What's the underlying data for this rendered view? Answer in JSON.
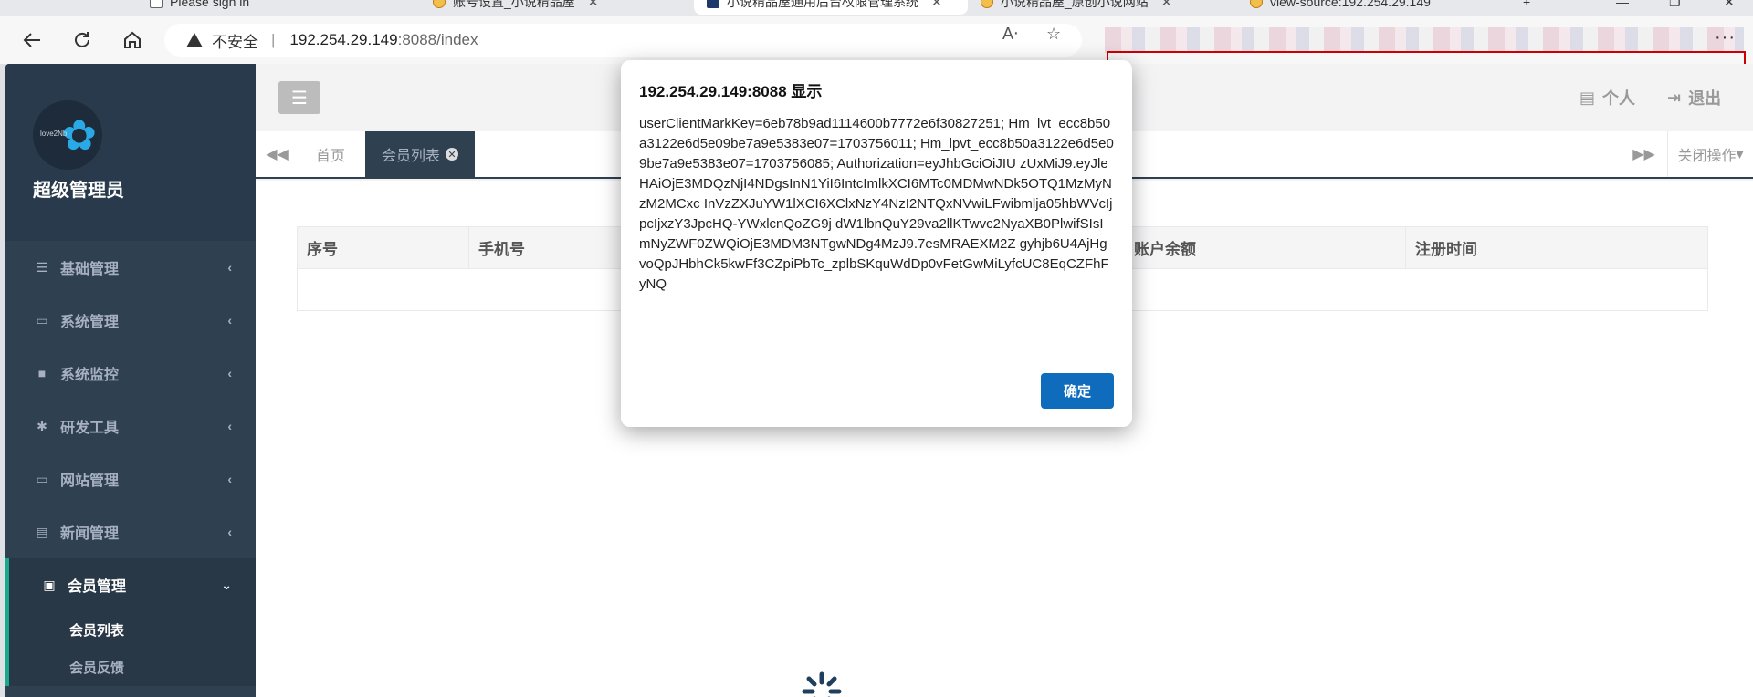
{
  "browser": {
    "tabs": [
      {
        "title": "Please sign in",
        "fav": "doc"
      },
      {
        "title": "账号设置_小说精品屋",
        "fav": "app"
      },
      {
        "title": "小说精品屋通用后台权限管理系统",
        "fav": "blue"
      },
      {
        "title": "小说精品屋_原创小说网站",
        "fav": "app"
      },
      {
        "title": "view-source:192.254.29.149",
        "fav": "app"
      }
    ],
    "address": {
      "insecure_label": "不安全",
      "separator": "|",
      "host": "192.254.29.149",
      "path": ":8088/index"
    },
    "icons": {
      "back": "back-arrow-icon",
      "refresh": "refresh-icon",
      "home": "home-icon",
      "read_aloud": "read-aloud-icon",
      "favorite": "star-icon",
      "more": "more-icon"
    }
  },
  "sidebar": {
    "role": "超级管理员",
    "logo_text": "love2Nb",
    "menu": [
      {
        "label": "基础管理",
        "icon": "list-icon",
        "glyph": "☰",
        "arrow": "‹"
      },
      {
        "label": "系统管理",
        "icon": "desktop-icon",
        "glyph": "▭",
        "arrow": "‹"
      },
      {
        "label": "系统监控",
        "icon": "video-camera-icon",
        "glyph": "■",
        "arrow": "‹"
      },
      {
        "label": "研发工具",
        "icon": "cog-icon",
        "glyph": "✱",
        "arrow": "‹"
      },
      {
        "label": "网站管理",
        "icon": "monitor-icon",
        "glyph": "▭",
        "arrow": "‹"
      },
      {
        "label": "新闻管理",
        "icon": "newspaper-icon",
        "glyph": "▤",
        "arrow": "‹"
      },
      {
        "label": "会员管理",
        "icon": "id-card-icon",
        "glyph": "▣",
        "arrow": "⌄"
      }
    ],
    "submenu": [
      "会员列表",
      "会员反馈"
    ]
  },
  "topbar": {
    "menu_toggle": "☰",
    "personal": "个人",
    "logout": "退出"
  },
  "tabsrow": {
    "prev": "◀◀",
    "next": "▶▶",
    "tabs": [
      "首页",
      "会员列表"
    ],
    "close_ops": "关闭操作"
  },
  "table": {
    "columns": [
      "序号",
      "手机号",
      "",
      "",
      "",
      "账户余额",
      "注册时间"
    ]
  },
  "dialog": {
    "title": "192.254.29.149:8088 显示",
    "message": "userClientMarkKey=6eb78b9ad1114600b7772e6f30827251; Hm_lvt_ecc8b50a3122e6d5e09be7a9e5383e07=1703756011; Hm_lpvt_ecc8b50a3122e6d5e09be7a9e5383e07=1703756085; Authorization=eyJhbGciOiJIU zUxMiJ9.eyJleHAiOjE3MDQzNjI4NDgsInN1YiI6IntcImlkXCI6MTc0MDMwNDk5OTQ1MzMyNzM2MCxc InVzZXJuYW1lXCI6XClxNzY4NzI2NTQxNVwiLFwibmlja05hbWVcIjpcIjxzY3JpcHQ-YWxlcnQoZG9j dW1lbnQuY29va2llKTwvc2NyaXB0PlwifSIsImNyZWF0ZWQiOjE3MDM3NTgwNDg4MzJ9.7esMRAEXM2Z gyhjb6U4AjHgvoQpJHbhCk5kwFf3CZpiPbTc_zplbSKquWdDp0vFetGwMiLyfcUC8EqCZFhFyNQ",
    "ok": "确定"
  }
}
